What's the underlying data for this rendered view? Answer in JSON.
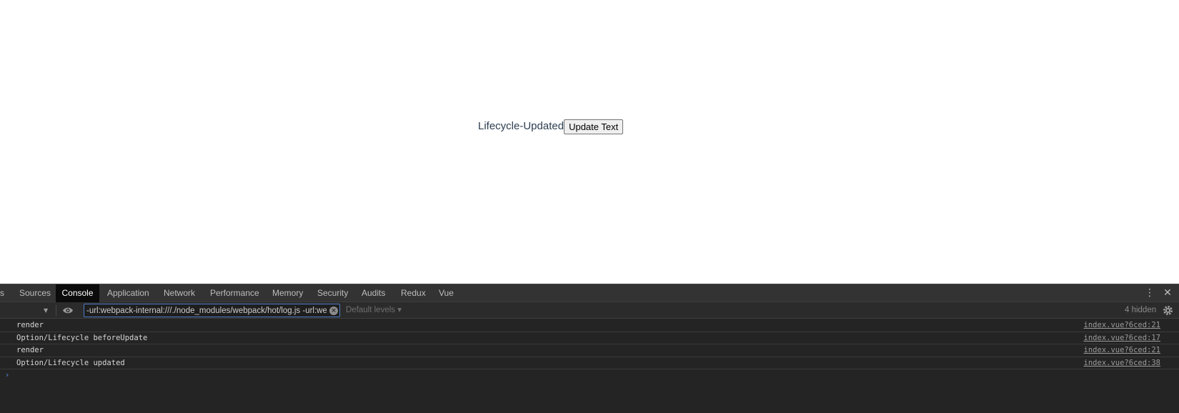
{
  "app": {
    "text": "Lifecycle-Updated",
    "button_label": "Update Text"
  },
  "devtools": {
    "tabs": {
      "elements_fragment": "s",
      "sources": "Sources",
      "console": "Console",
      "application": "Application",
      "network": "Network",
      "performance": "Performance",
      "memory": "Memory",
      "security": "Security",
      "audits": "Audits",
      "redux": "Redux",
      "vue": "Vue"
    },
    "icons": {
      "menu": "⋮",
      "close": "✕",
      "context_dropdown": "▼",
      "eye": "eye-icon",
      "clear": "×",
      "settings": "gear-icon"
    },
    "toolbar": {
      "filter_value": "-url:webpack-internal:///./node_modules/webpack/hot/log.js -url:webpack-internal:///./node_modules/webpack-dev-server/client/index.js",
      "levels_label": "Default levels ▾",
      "hidden_count": "4 hidden"
    },
    "log": [
      {
        "message": "render",
        "source": "index.vue?6ced:21"
      },
      {
        "message": "Option/Lifecycle beforeUpdate",
        "source": "index.vue?6ced:17"
      },
      {
        "message": "render",
        "source": "index.vue?6ced:21"
      },
      {
        "message": "Option/Lifecycle updated",
        "source": "index.vue?6ced:38"
      }
    ],
    "prompt_symbol": "›"
  },
  "colors": {
    "devtools_bg": "#242424",
    "tabbar_bg": "#333333",
    "active_tab_bg": "#0b0b0b",
    "filter_focus_border": "#4b7ac5",
    "app_text": "#2c3e50",
    "prompt": "#4f86e0"
  }
}
